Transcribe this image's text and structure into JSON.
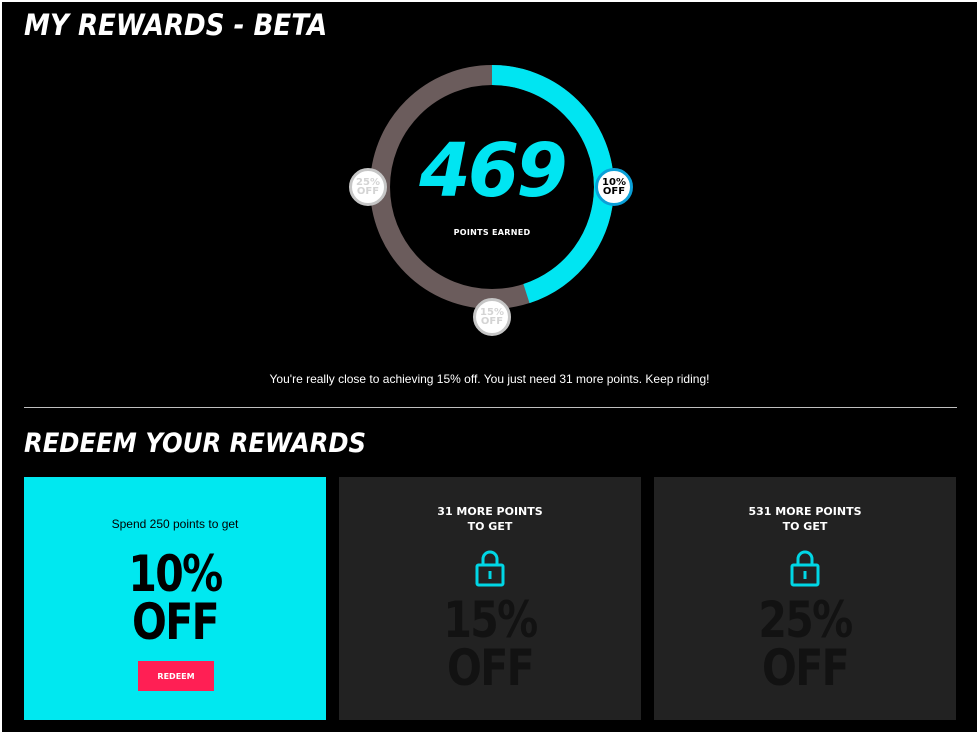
{
  "header": {
    "title": "MY REWARDS - BETA"
  },
  "progress": {
    "points": "469",
    "points_label": "POINTS EARNED",
    "ring_fraction": 0.45,
    "accent_color": "#00e5f2",
    "ring_track_color": "#6b5c5c",
    "milestones": [
      {
        "pct": "10%",
        "off": "OFF",
        "state": "unlocked"
      },
      {
        "pct": "15%",
        "off": "OFF",
        "state": "locked"
      },
      {
        "pct": "25%",
        "off": "OFF",
        "state": "locked"
      }
    ],
    "message": "You're really close to achieving 15% off. You just need 31 more points. Keep riding!"
  },
  "redeem": {
    "title": "REDEEM YOUR REWARDS",
    "cards": [
      {
        "caption": "Spend 250 points to get",
        "value": "10%",
        "off": "OFF",
        "button_label": "REDEEM",
        "state": "active",
        "color": "#00e8f0"
      },
      {
        "line1": "31 MORE POINTS",
        "line2": "TO GET",
        "value": "15%",
        "off": "OFF",
        "icon": "lock-icon",
        "state": "locked"
      },
      {
        "line1": "531 MORE POINTS",
        "line2": "TO GET",
        "value": "25%",
        "off": "OFF",
        "icon": "lock-icon",
        "state": "locked"
      }
    ],
    "button_color": "#ff1f54"
  }
}
